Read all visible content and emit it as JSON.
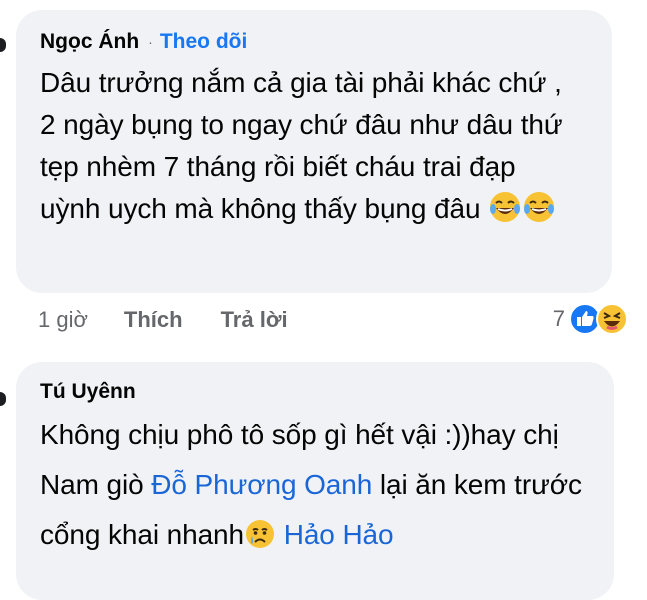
{
  "comments": [
    {
      "author": "Ngọc Ánh",
      "separator": "·",
      "follow_label": "Theo dõi",
      "text": "Dâu trưởng nắm cả gia tài phải khác chứ , 2 ngày bụng to ngay chứ đâu như dâu thứ tẹp nhèm 7 tháng rồi biết cháu trai đạp uỳnh uych mà không thấy bụng đâu",
      "emojis": [
        "laughing-tears",
        "laughing-tears"
      ],
      "time": "1 giờ",
      "like_label": "Thích",
      "reply_label": "Trả lời",
      "reaction_count": "7",
      "reactions": [
        "like",
        "haha"
      ]
    },
    {
      "author": "Tú Uyênn",
      "text_part1": "Không chịu phô tô sốp gì hết vậi :))hay chị Nam giò ",
      "mention1": "Đỗ Phương Oanh",
      "text_part2": "  lại ăn kem trước cổng khai nhanh",
      "emoji": "crying-face",
      "mention2": " Hảo Hảo"
    }
  ],
  "colors": {
    "bubble": "#f0f2f5",
    "text": "#050505",
    "secondary": "#65676b",
    "link": "#1877f2"
  }
}
